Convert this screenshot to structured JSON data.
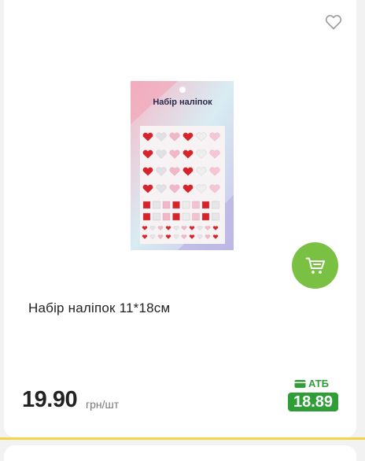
{
  "product": {
    "title": "Набір наліпок 11*18см",
    "image_label": "Набір наліпок",
    "price": "19.90",
    "unit": "грн/шт",
    "promo": {
      "brand": "АТБ",
      "price": "18.89"
    }
  },
  "icons": {
    "favorite": "heart-outline-icon",
    "cart": "cart-icon",
    "wallet": "wallet-icon"
  },
  "colors": {
    "accent_green": "#7ac143",
    "promo_green": "#2f9e36",
    "divider_yellow": "#f5d547"
  }
}
